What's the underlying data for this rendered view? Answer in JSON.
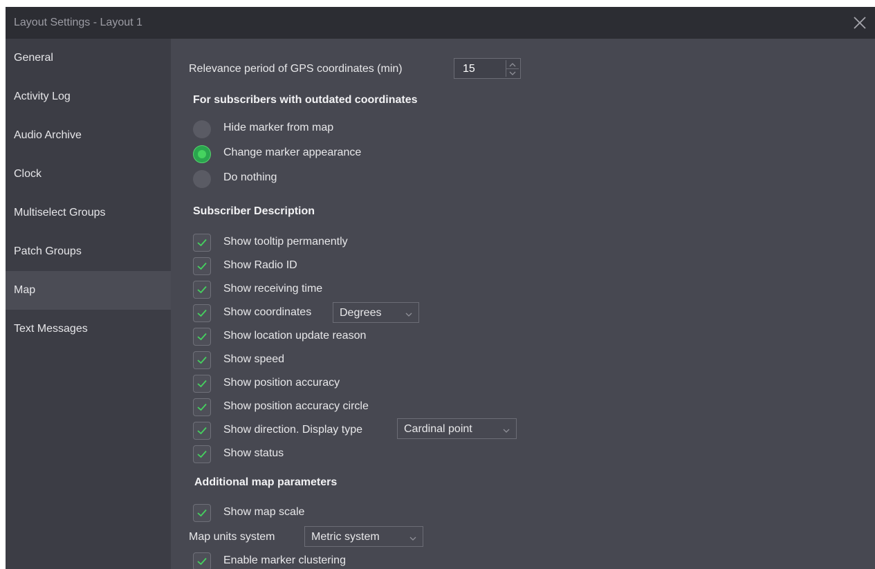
{
  "window": {
    "title": "Layout Settings - Layout 1"
  },
  "sidebar": {
    "items": [
      {
        "label": "General"
      },
      {
        "label": "Activity Log"
      },
      {
        "label": "Audio Archive"
      },
      {
        "label": "Clock"
      },
      {
        "label": "Multiselect Groups"
      },
      {
        "label": "Patch Groups"
      },
      {
        "label": "Map",
        "active": true
      },
      {
        "label": "Text Messages"
      }
    ]
  },
  "gps": {
    "label": "Relevance period of GPS coordinates (min)",
    "value": "15"
  },
  "outdated": {
    "heading": "For subscribers with outdated coordinates",
    "options": [
      {
        "label": "Hide marker from map",
        "selected": false
      },
      {
        "label": "Change marker appearance",
        "selected": true
      },
      {
        "label": "Do nothing",
        "selected": false
      }
    ]
  },
  "description": {
    "heading": "Subscriber Description",
    "checks": [
      {
        "label": "Show tooltip permanently",
        "checked": true
      },
      {
        "label": "Show Radio ID",
        "checked": true
      },
      {
        "label": "Show receiving time",
        "checked": true
      },
      {
        "label": "Show coordinates",
        "checked": true,
        "select": "Degrees"
      },
      {
        "label": "Show location update reason",
        "checked": true
      },
      {
        "label": "Show speed",
        "checked": true
      },
      {
        "label": "Show position accuracy",
        "checked": true
      },
      {
        "label": "Show position accuracy circle",
        "checked": true
      },
      {
        "label": "Show direction. Display type",
        "checked": true,
        "select": "Cardinal point"
      },
      {
        "label": "Show status",
        "checked": true
      }
    ]
  },
  "map_params": {
    "heading": "Additional map parameters",
    "show_scale": {
      "label": "Show map scale",
      "checked": true
    },
    "units": {
      "label": "Map units system",
      "value": "Metric system"
    },
    "clustering": {
      "label": "Enable marker clustering",
      "checked": true
    }
  },
  "colors": {
    "accent": "#45d35f",
    "window_bg": "#474851",
    "sidebar_bg": "#3c3d45",
    "titlebar_bg": "#2c2d33"
  }
}
